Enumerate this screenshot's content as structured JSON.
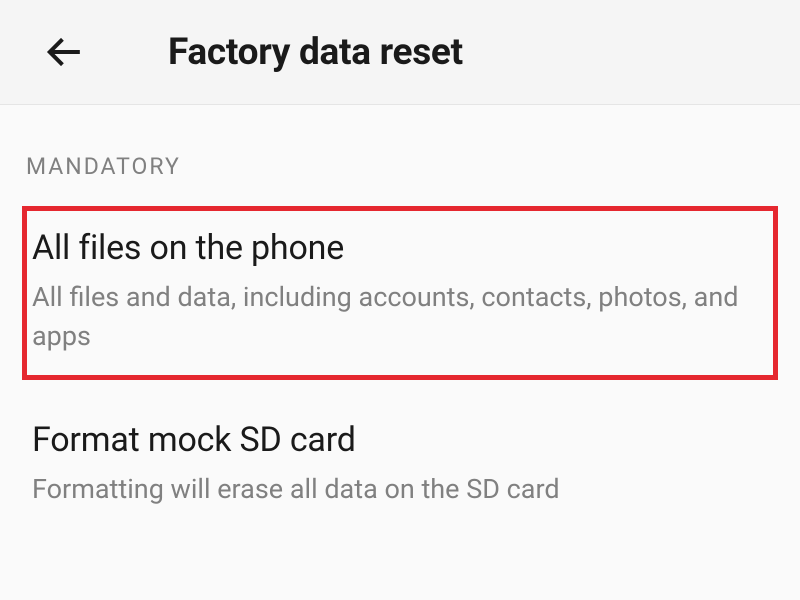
{
  "header": {
    "title": "Factory data reset"
  },
  "section": {
    "label": "MANDATORY"
  },
  "options": [
    {
      "title": "All files on the phone",
      "description": "All files and data, including accounts, contacts, photos, and apps",
      "highlighted": true
    },
    {
      "title": "Format mock SD card",
      "description": "Formatting will erase all data on the SD card",
      "highlighted": false
    }
  ]
}
